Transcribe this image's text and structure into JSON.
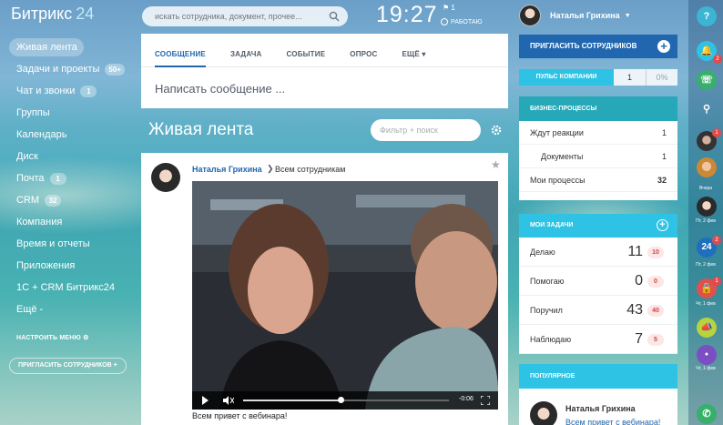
{
  "app": {
    "logo_text": "Битрикс",
    "logo_num": "24"
  },
  "sidebar": {
    "items": [
      {
        "label": "Живая лента",
        "badge": ""
      },
      {
        "label": "Задачи и проекты",
        "badge": "50+"
      },
      {
        "label": "Чат и звонки",
        "badge": "1"
      },
      {
        "label": "Группы",
        "badge": ""
      },
      {
        "label": "Календарь",
        "badge": ""
      },
      {
        "label": "Диск",
        "badge": ""
      },
      {
        "label": "Почта",
        "badge": "1"
      },
      {
        "label": "CRM",
        "badge": "32"
      },
      {
        "label": "Компания",
        "badge": ""
      },
      {
        "label": "Время и отчеты",
        "badge": ""
      },
      {
        "label": "Приложения",
        "badge": ""
      },
      {
        "label": "1С + CRM Битрикс24",
        "badge": ""
      },
      {
        "label": "Ещё -",
        "badge": ""
      }
    ],
    "setup_label": "НАСТРОИТЬ МЕНЮ",
    "invite_label": "ПРИГЛАСИТЬ СОТРУДНИКОВ +"
  },
  "search": {
    "placeholder": "искать сотрудника, документ, прочее..."
  },
  "clock": {
    "time": "19:27",
    "flag_count": "1",
    "status": "РАБОТАЮ"
  },
  "user": {
    "name": "Наталья Грихина"
  },
  "composer": {
    "tabs": [
      "СООБЩЕНИЕ",
      "ЗАДАЧА",
      "СОБЫТИЕ",
      "ОПРОС",
      "ЕЩЁ ▾"
    ],
    "placeholder": "Написать сообщение ..."
  },
  "feed": {
    "title": "Живая лента",
    "filter_placeholder": "Фильтр + поиск"
  },
  "post": {
    "author": "Наталья Грихина",
    "arrow": "❯",
    "recipient": "Всем сотрудникам",
    "video_time": "-0:06",
    "caption": "Всем привет с вебинара!"
  },
  "right": {
    "invite_label": "ПРИГЛАСИТЬ СОТРУДНИКОВ",
    "pulse": {
      "label": "ПУЛЬС КОМПАНИИ",
      "value": "1",
      "percent": "0%"
    },
    "bp": {
      "title": "БИЗНЕС-ПРОЦЕССЫ",
      "rows": [
        {
          "label": "Ждут реакции",
          "value": "1"
        },
        {
          "label": "Документы",
          "value": "1"
        },
        {
          "label": "Мои процессы",
          "value": "32"
        }
      ]
    },
    "tasks": {
      "title": "МОИ ЗАДАЧИ",
      "rows": [
        {
          "label": "Делаю",
          "value": "11",
          "badge": "10"
        },
        {
          "label": "Помогаю",
          "value": "0",
          "badge": "0"
        },
        {
          "label": "Поручил",
          "value": "43",
          "badge": "40"
        },
        {
          "label": "Наблюдаю",
          "value": "7",
          "badge": "5"
        }
      ]
    },
    "popular": {
      "title": "ПОПУЛЯРНОЕ",
      "name": "Наталья Грихина",
      "text": "Всем привет с вебинара!"
    }
  },
  "strip": {
    "help": "?",
    "badge_notify": "2",
    "badge_user1": "1",
    "label_yesterday": "Вчера",
    "label_time1": "Пт, 2 фев",
    "label_time2": "Пт, 2 фев",
    "label_time3": "Чт, 1 фев",
    "label_time4": "Чт, 1 фев",
    "badge_24": "2",
    "badge_lock": "1",
    "tile_24": "24"
  },
  "colors": {
    "accent": "#2067b0",
    "teal": "#27a8b8",
    "cyan": "#2ec3e5"
  }
}
